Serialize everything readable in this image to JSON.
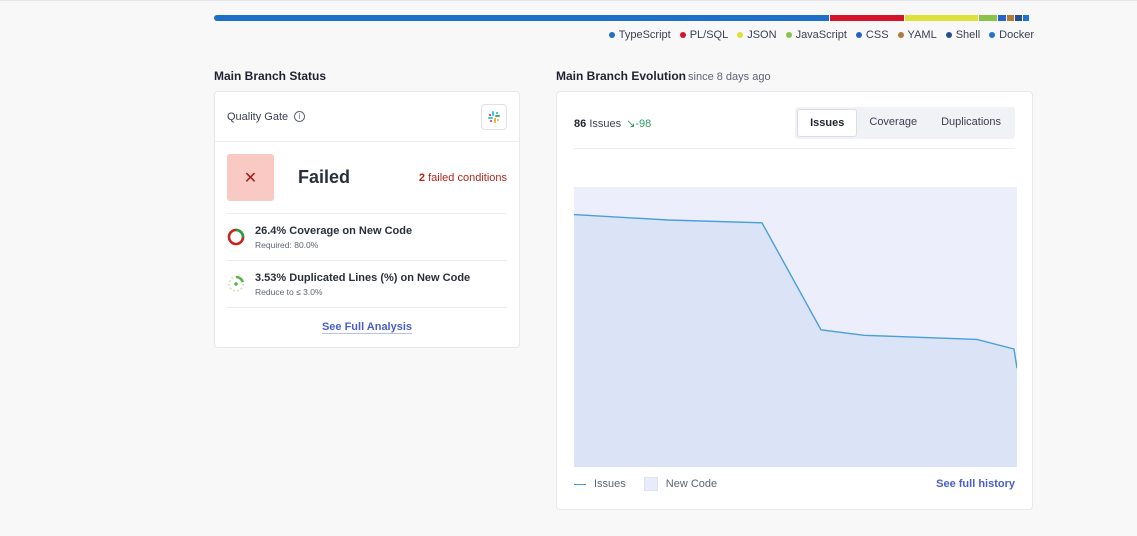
{
  "languages": [
    {
      "name": "TypeScript",
      "color": "#1e6fc8",
      "share": 0.757
    },
    {
      "name": "PL/SQL",
      "color": "#d5142b",
      "share": 0.091
    },
    {
      "name": "JSON",
      "color": "#dde13a",
      "share": 0.089
    },
    {
      "name": "JavaScript",
      "color": "#8bc34a",
      "share": 0.022
    },
    {
      "name": "CSS",
      "color": "#2563c9",
      "share": 0.01
    },
    {
      "name": "YAML",
      "color": "#b07a3a",
      "share": 0.009
    },
    {
      "name": "Shell",
      "color": "#27508f",
      "share": 0.008
    },
    {
      "name": "Docker",
      "color": "#1e73d6",
      "share": 0.008
    }
  ],
  "status": {
    "title": "Main Branch Status",
    "quality_gate_label": "Quality Gate",
    "info_icon": "info-icon",
    "slack_icon": "slack-icon",
    "result_icon": "✕",
    "result": "Failed",
    "failed_count": "2",
    "failed_suffix": "failed conditions",
    "conditions": [
      {
        "title": "26.4% Coverage on New Code",
        "sub": "Required: 80.0%",
        "icon": "coverage-donut-icon"
      },
      {
        "title": "3.53% Duplicated Lines (%) on New Code",
        "sub": "Reduce to ≤ 3.0%",
        "icon": "duplication-donut-icon"
      }
    ],
    "see_full": "See Full Analysis"
  },
  "evolution": {
    "title": "Main Branch Evolution",
    "subtitle": "since 8 days ago",
    "issues_count": "86",
    "issues_word": "Issues",
    "delta": "↘-98",
    "tabs": [
      "Issues",
      "Coverage",
      "Duplications"
    ],
    "active_tab": "Issues",
    "legend_issues": "Issues",
    "legend_new_code": "New Code",
    "see_history": "See full history",
    "line_color": "#4a9fd8",
    "fill_color": "#dbe3f6",
    "new_code_color": "#eceefb",
    "series": [
      184,
      182,
      180,
      178,
      100,
      96,
      93,
      86,
      72
    ]
  }
}
